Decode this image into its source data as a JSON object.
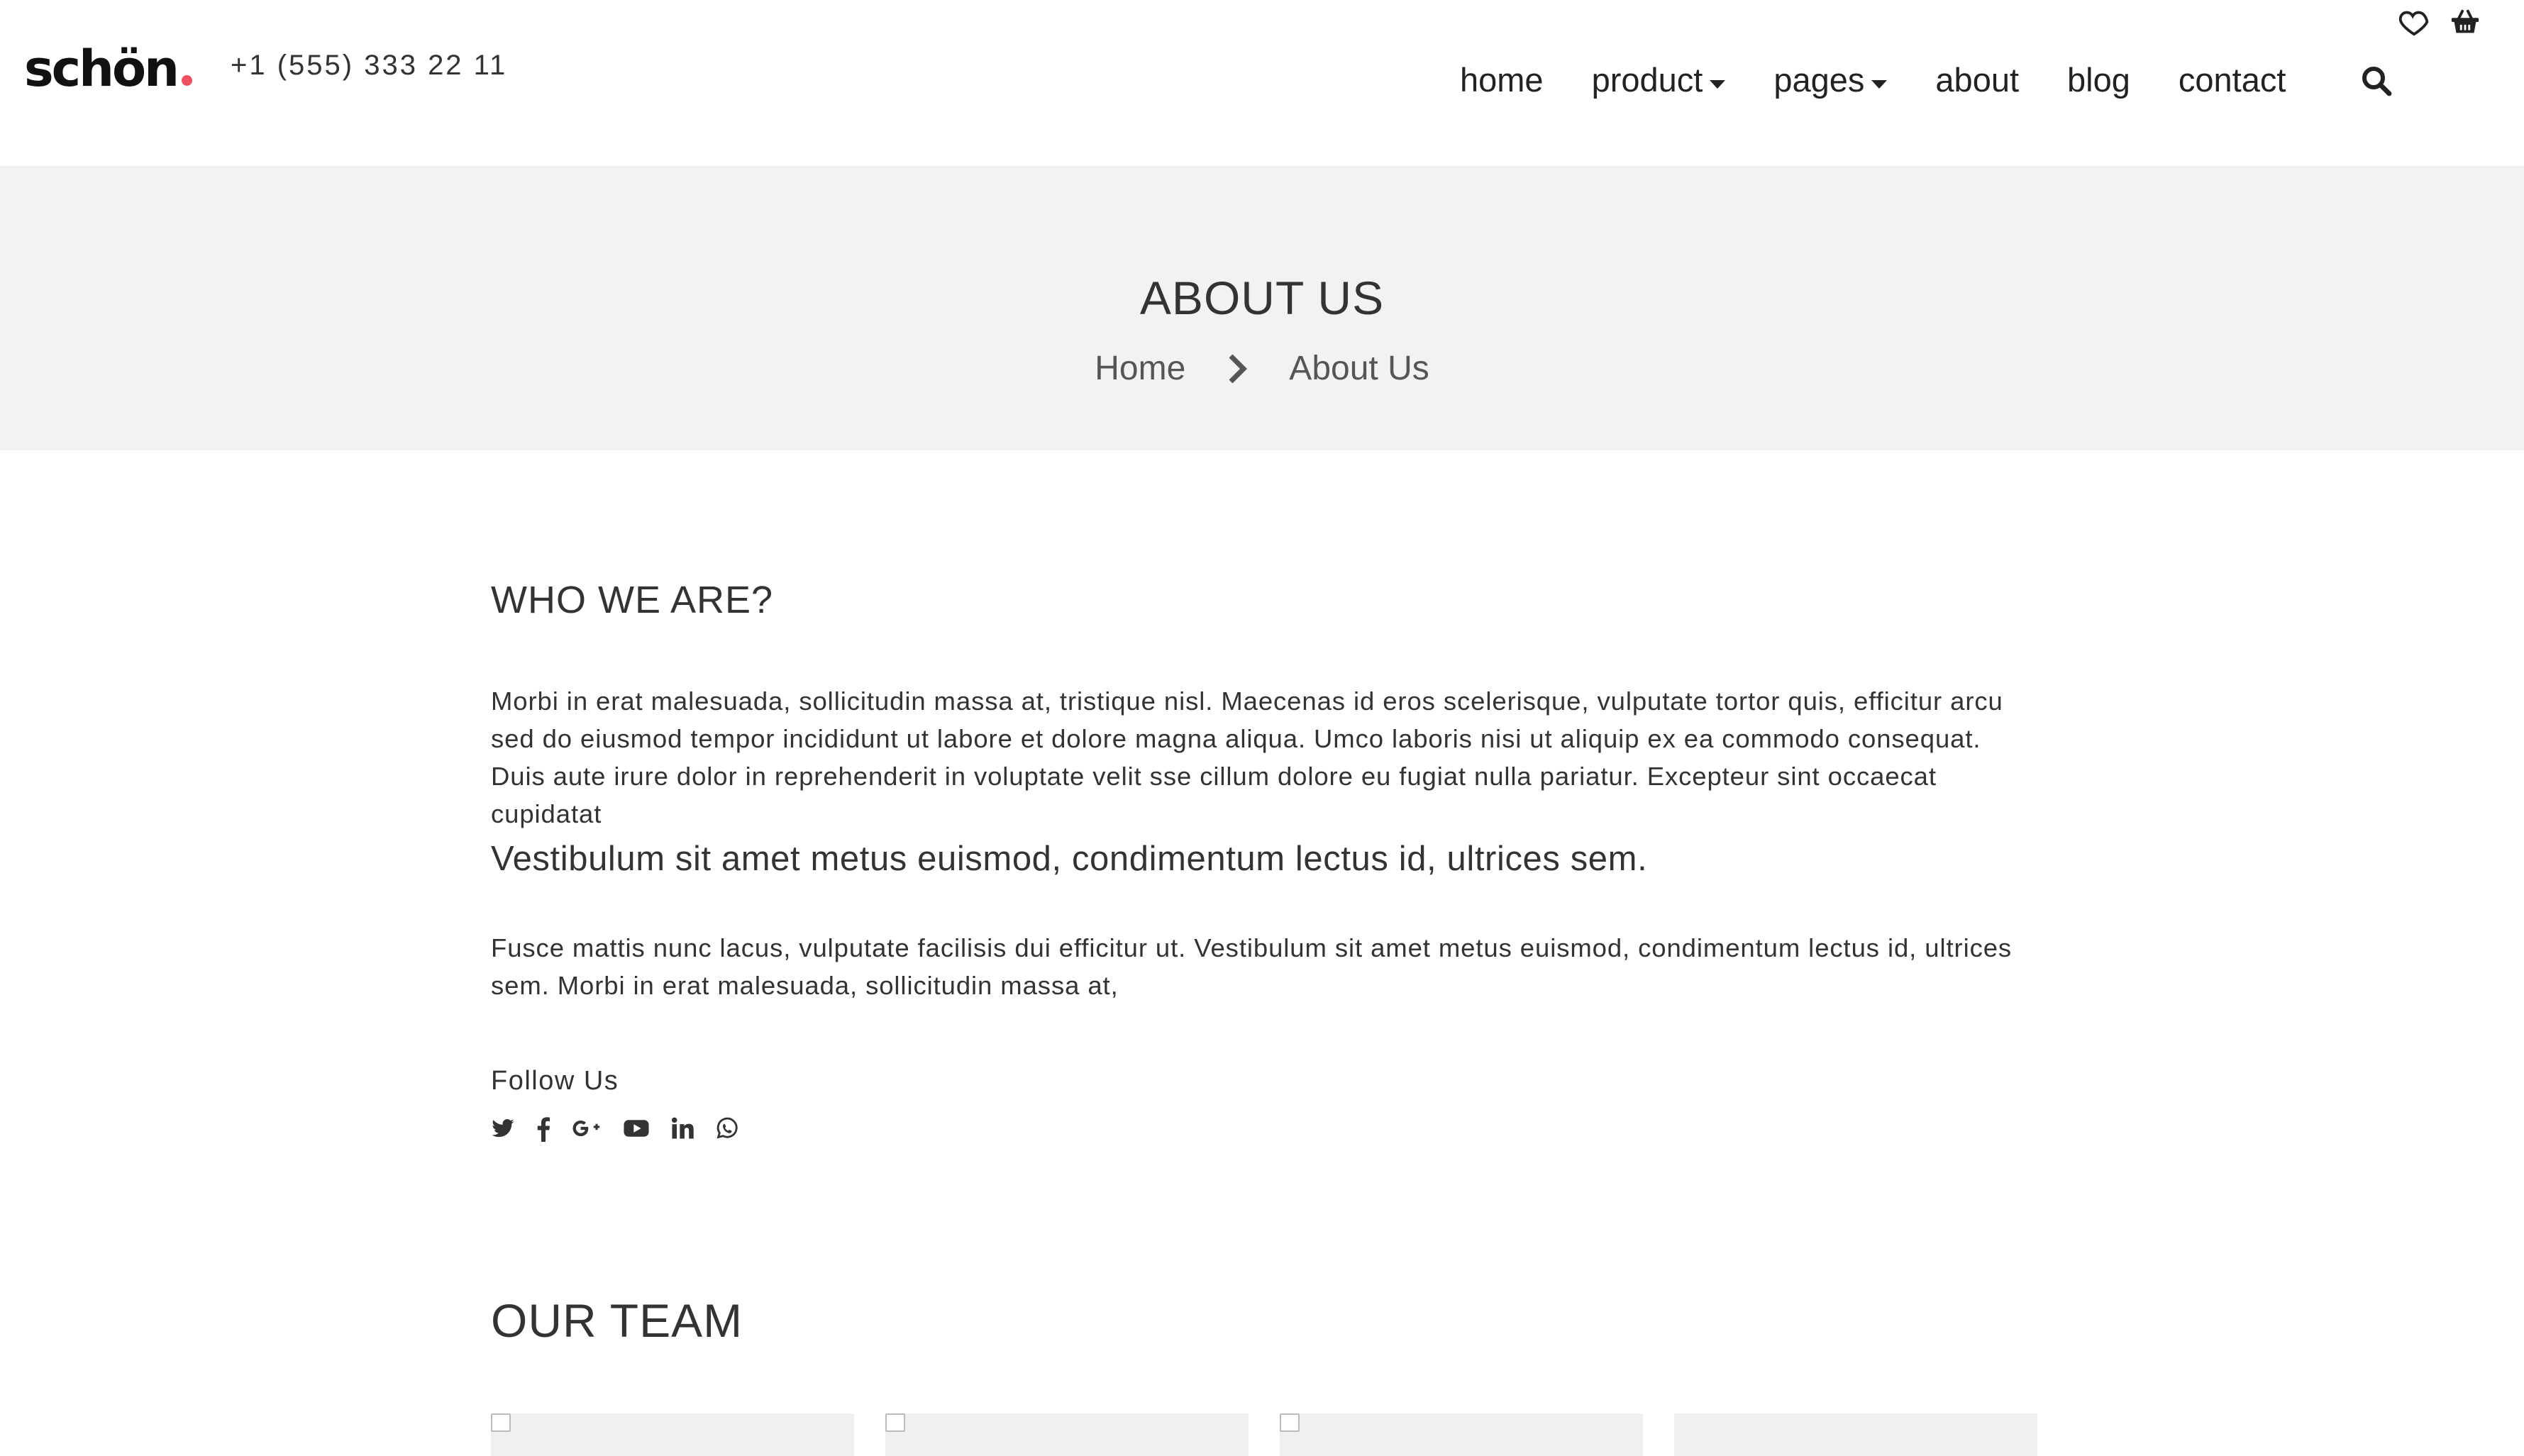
{
  "header": {
    "logo_text": "schön",
    "phone": "+1 (555) 333 22 11",
    "nav": [
      {
        "label": "home",
        "has_dropdown": false
      },
      {
        "label": "product",
        "has_dropdown": true
      },
      {
        "label": "pages",
        "has_dropdown": true
      },
      {
        "label": "about",
        "has_dropdown": false
      },
      {
        "label": "blog",
        "has_dropdown": false
      },
      {
        "label": "contact",
        "has_dropdown": false
      }
    ],
    "icons": [
      "heart-icon",
      "basket-icon",
      "search-icon"
    ]
  },
  "banner": {
    "title": "ABOUT US",
    "breadcrumb": {
      "home": "Home",
      "current": "About Us"
    }
  },
  "about": {
    "heading": "WHO WE ARE?",
    "paragraph1": "Morbi in erat malesuada, sollicitudin massa at, tristique nisl. Maecenas id eros scelerisque, vulputate tortor quis, efficitur arcu sed do eiusmod tempor incididunt ut labore et dolore magna aliqua. Umco laboris nisi ut aliquip ex ea commodo consequat. Duis aute irure dolor in reprehenderit in voluptate velit sse cillum dolore eu fugiat nulla pariatur. Excepteur sint occaecat cupidatat",
    "lead": "Vestibulum sit amet metus euismod, condimentum lectus id, ultrices sem.",
    "paragraph2": "Fusce mattis nunc lacus, vulputate facilisis dui efficitur ut. Vestibulum sit amet metus euismod, condimentum lectus id, ultrices sem. Morbi in erat malesuada, sollicitudin massa at,",
    "follow_label": "Follow Us",
    "socials": [
      "twitter-icon",
      "facebook-icon",
      "google-plus-icon",
      "youtube-icon",
      "linkedin-icon",
      "whatsapp-icon"
    ]
  },
  "team": {
    "heading": "OUR TEAM",
    "member_count": 4
  },
  "colors": {
    "accent": "#f0505f",
    "banner_bg": "#f2f2f2",
    "text": "#333333"
  }
}
